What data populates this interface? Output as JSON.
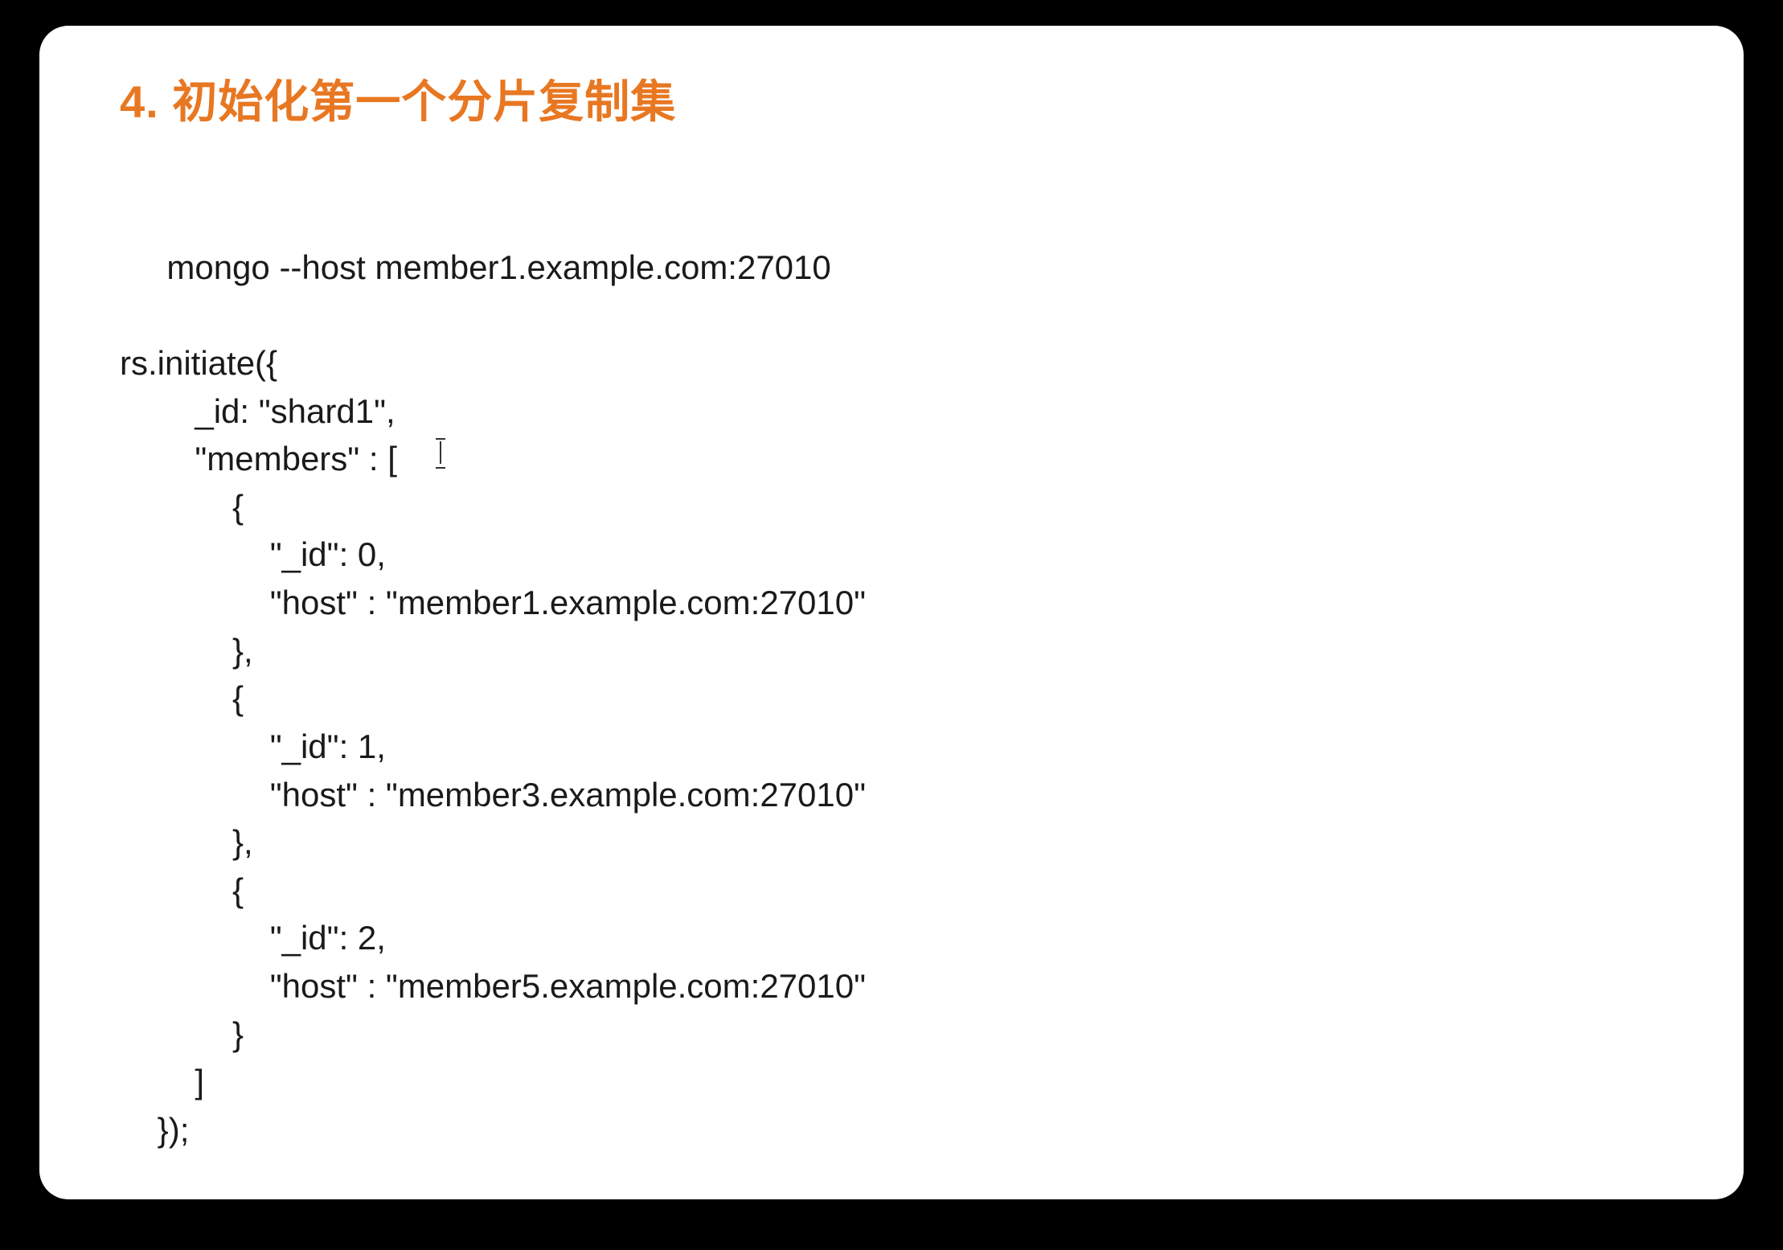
{
  "slide": {
    "title": "4. 初始化第一个分片复制集",
    "code": " mongo --host member1.example.com:27010\n\nrs.initiate({\n        _id: \"shard1\",\n        \"members\" : [\n            {\n                \"_id\": 0,\n                \"host\" : \"member1.example.com:27010\"\n            },\n            {\n                \"_id\": 1,\n                \"host\" : \"member3.example.com:27010\"\n            },\n            {\n                \"_id\": 2,\n                \"host\" : \"member5.example.com:27010\"\n            }\n        ]\n    });"
  }
}
